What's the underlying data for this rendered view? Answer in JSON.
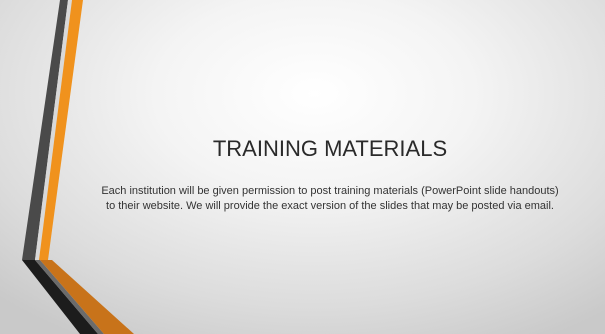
{
  "slide": {
    "title": "TRAINING MATERIALS",
    "body": "Each institution will be given permission to post training materials (PowerPoint slide handouts) to their website. We will provide the exact version of the slides that may be posted via email."
  },
  "colors": {
    "accent_orange": "#f0921d",
    "stripe_dark": "#4a4a4a",
    "stripe_black": "#1c1c1c",
    "bottom_orange": "#c8731a"
  }
}
